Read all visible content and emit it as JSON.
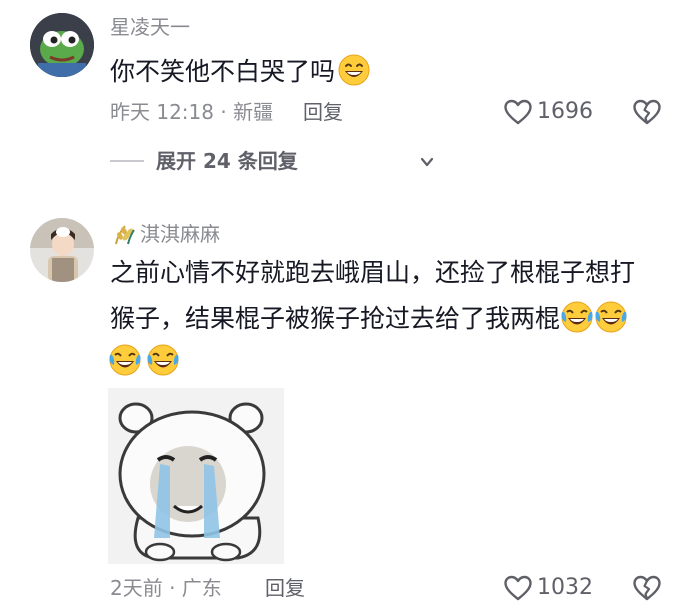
{
  "comments": [
    {
      "username": "星凌天一",
      "text": "你不笑他不白哭了吗",
      "time_location": "昨天 12:18 · 新疆",
      "reply_label": "回复",
      "likes": "1696",
      "expand_label": "展开 24 条回复"
    },
    {
      "username": "淇淇麻麻",
      "text_line1": "之前心情不好就跑去峨眉山，还捡了根棍子想打",
      "text_line2": "猴子，结果棍子被猴子抢过去给了我两棍",
      "time_location": "2天前 · 广东",
      "reply_label": "回复",
      "likes": "1032"
    }
  ],
  "icons": {
    "like": "heart-outline-icon",
    "dislike": "broken-heart-icon",
    "expand": "chevron-down-icon",
    "badge": "wheat-badge-icon",
    "smile": "smiling-emoji",
    "laugh_cry": "rofl-emoji",
    "sticker": "crying-bear-sticker"
  },
  "colors": {
    "text": "#161823",
    "muted": "#8a8b91",
    "action": "#5f6068"
  }
}
